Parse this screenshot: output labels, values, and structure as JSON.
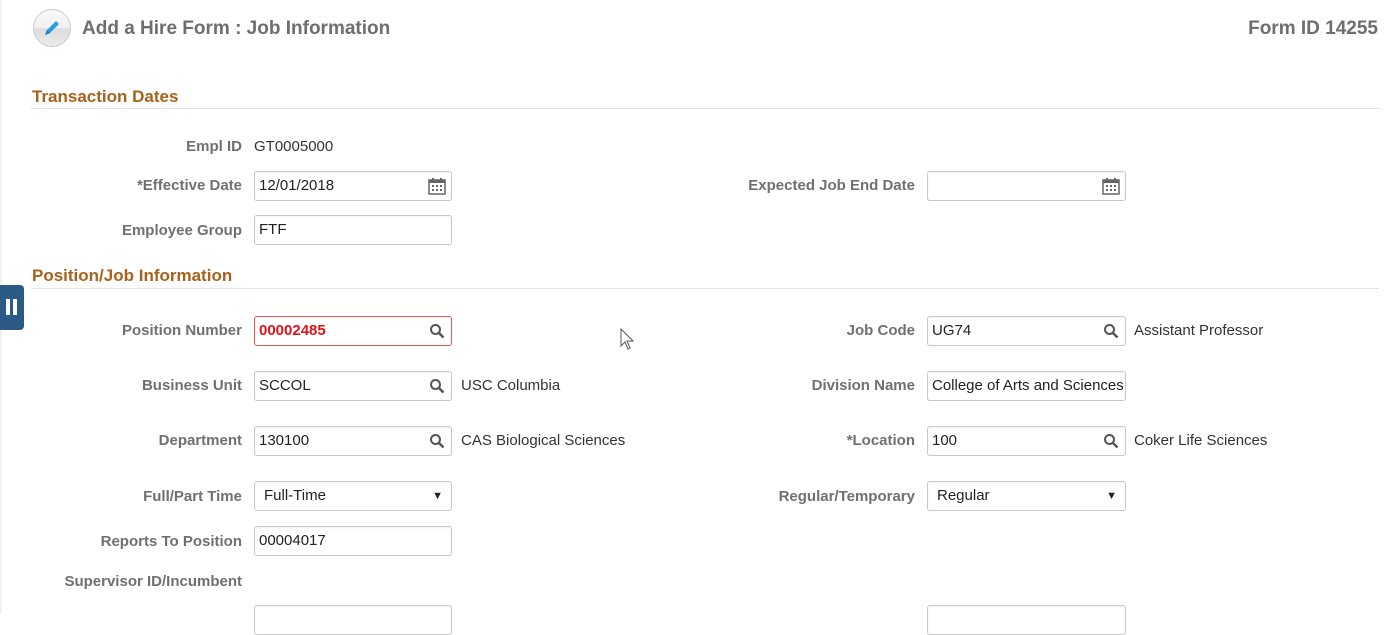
{
  "header": {
    "icon": "pencil-icon",
    "title": "Add a Hire Form :  Job Information",
    "form_id": "Form ID 14255"
  },
  "sections": {
    "transaction_dates": "Transaction Dates",
    "position_job": "Position/Job Information"
  },
  "transaction": {
    "empl_id_label": "Empl ID",
    "empl_id_value": "GT0005000",
    "effective_date_label": "*Effective Date",
    "effective_date_value": "12/01/2018",
    "expected_end_label": "Expected Job End Date",
    "expected_end_value": "",
    "employee_group_label": "Employee Group",
    "employee_group_value": "FTF"
  },
  "position": {
    "position_number_label": "Position Number",
    "position_number_value": "00002485",
    "job_code_label": "Job Code",
    "job_code_value": "UG74",
    "job_code_desc": "Assistant Professor",
    "business_unit_label": "Business Unit",
    "business_unit_value": "SCCOL",
    "business_unit_desc": "USC Columbia",
    "division_name_label": "Division Name",
    "division_name_value": "College of Arts and Sciences",
    "department_label": "Department",
    "department_value": "130100",
    "department_desc": "CAS Biological Sciences",
    "location_label": "*Location",
    "location_value": "100",
    "location_desc": "Coker Life Sciences",
    "full_part_label": "Full/Part Time",
    "full_part_value": "Full-Time",
    "reg_temp_label": "Regular/Temporary",
    "reg_temp_value": "Regular",
    "reports_to_label": "Reports To Position",
    "reports_to_value": "00004017",
    "supervisor_label": "Supervisor ID/Incumbent"
  },
  "colors": {
    "section_title": "#a8621d",
    "error": "#e0131a",
    "handle": "#2c5a86"
  }
}
